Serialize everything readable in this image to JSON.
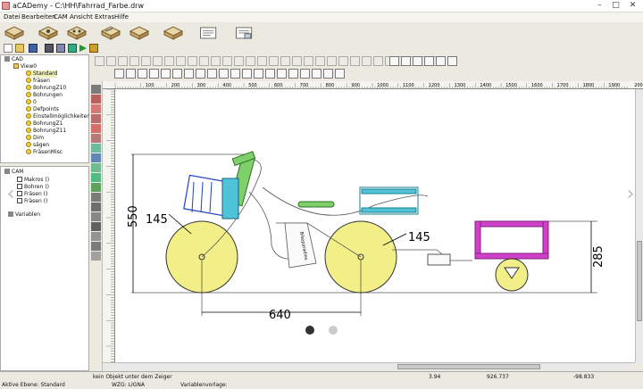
{
  "window": {
    "title": "aCADemy - C:\\HH\\Fahrrad_Farbe.drw"
  },
  "menu": [
    "Datei",
    "Bearbeiten",
    "CAM",
    "Ansicht",
    "Extras",
    "Hilfe"
  ],
  "tree_cad": {
    "root": "CAD",
    "view": "View0",
    "layers": [
      "Standard",
      "fräsen",
      "BohrungZ10",
      "Bohrungen",
      "0",
      "Defpoints",
      "Einstellmöglichkeiten",
      "BohrungZ1",
      "BohrungZ11",
      "Dim",
      "sägen",
      "FräsenMisc"
    ]
  },
  "tree_cam": {
    "root": "CAM",
    "items": [
      "Makros ()",
      "Bohren ()",
      "Fräsen ()",
      "Fräsen ()"
    ],
    "vars": "Variablen"
  },
  "ruler_labels": [
    "100",
    "200",
    "300",
    "400",
    "500",
    "600",
    "700",
    "800",
    "900",
    "1000",
    "1100",
    "1200",
    "1300",
    "1400",
    "1500",
    "1600",
    "1700",
    "1800",
    "1900",
    "2000"
  ],
  "drawing": {
    "dim_height": "550",
    "dim_radius_left": "145",
    "dim_radius_right": "145",
    "dim_length": "640",
    "dim_trailer": "285",
    "text_on_frame": "Bikeparadies"
  },
  "status": {
    "hint": "kein Objekt unter dem Zeiger",
    "value_a": "3.94",
    "coord_x": "926.737",
    "coord_y": "-98.833",
    "layer": "Aktive Ebene: Standard",
    "tool": "WZG: LIGNA",
    "template": "Variablenvorlage:"
  },
  "colors": {
    "wheel_fill": "#f2ee88",
    "frame_green": "#7fd06a",
    "basket_cyan": "#4fc3d8",
    "box_blue": "#2040c0",
    "trailer_magenta": "#d040c8"
  },
  "carousel": {
    "prev": "‹",
    "next": "›"
  }
}
